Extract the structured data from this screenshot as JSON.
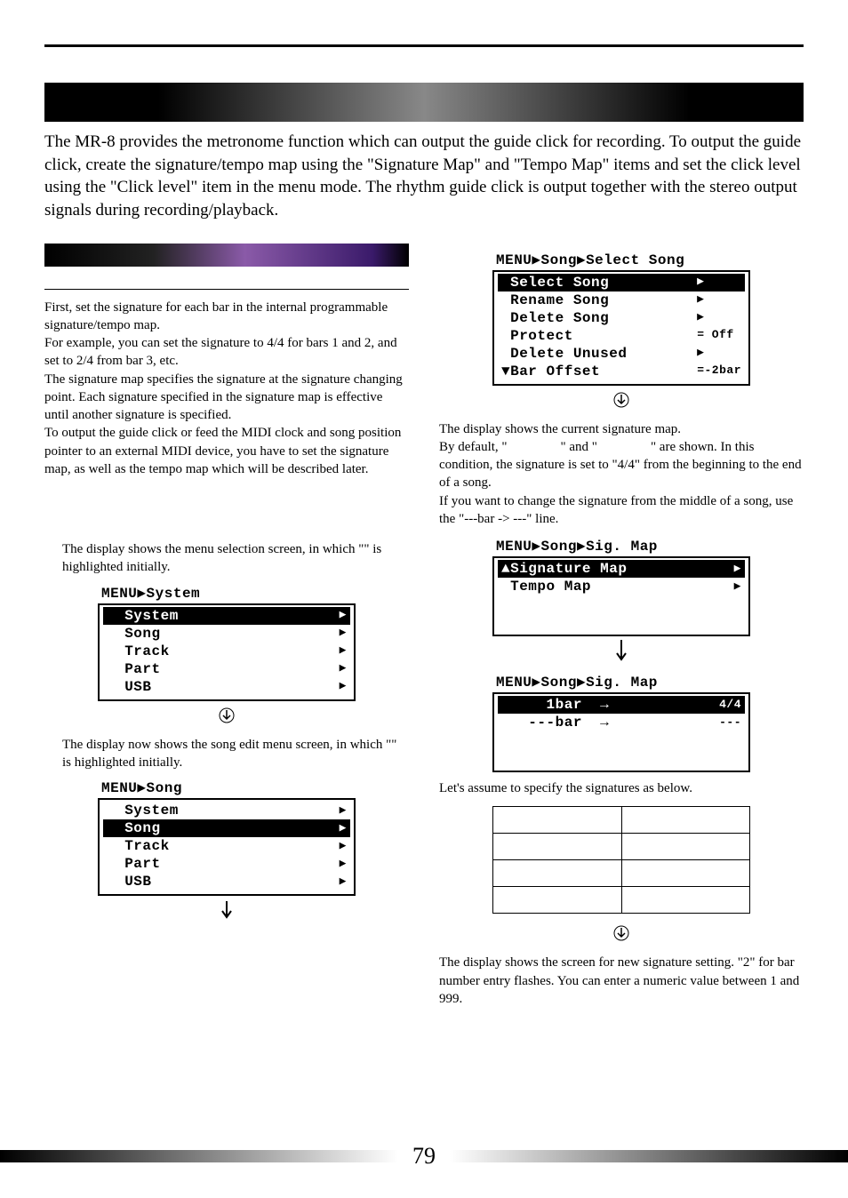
{
  "intro": "The MR-8 provides the metronome function which can output the guide click for recording. To output the guide click, create the signature/tempo map using the \"Signature Map\" and \"Tempo Map\" items and set the click level using the \"Click level\" item in the menu mode. The rhythm guide click is output together with the stereo output signals during recording/playback.",
  "left": {
    "p1": "First, set the signature for each bar in the internal programmable signature/tempo map.",
    "p2": "For example, you can set the signature to 4/4 for bars 1 and 2, and set to 2/4 from bar 3, etc.",
    "p3": "The signature map specifies the signature at the signature changing point. Each signature specified in the signature map is effective until another signature is specified.",
    "p4": "To output the guide click or feed the MIDI clock and song position pointer to an external MIDI device, you have to set the signature map, as well as the tempo map which will be described later.",
    "step1a": "The display shows the menu selection screen, in which \"",
    "step1b": "\" is highlighted initially.",
    "step2a": "The display now shows the song edit menu screen, in which \"",
    "step2b": "\" is highlighted initially."
  },
  "right": {
    "p1a": "The display shows the current signature map.",
    "p1b": "By default, \"",
    "p1c": "\" and \"",
    "p1d": "\" are shown. In this condition, the signature is set to \"4/4\" from the beginning to the end of a song.",
    "p2": "If you want to change the signature from the middle of a song, use the \"---bar -> ---\" line.",
    "p3": "Let's assume to specify the signatures as below.",
    "p4": "The display shows the screen for new signature setting. \"2\" for bar number entry flashes. You can enter a numeric value between 1 and 999."
  },
  "lcd1": {
    "title": "MENU▶System",
    "rows": [
      {
        "label": "  System",
        "arrow": "▶",
        "inv": true
      },
      {
        "label": "  Song",
        "arrow": "▶",
        "inv": false
      },
      {
        "label": "  Track",
        "arrow": "▶",
        "inv": false
      },
      {
        "label": "  Part",
        "arrow": "▶",
        "inv": false
      },
      {
        "label": "  USB",
        "arrow": "▶",
        "inv": false
      }
    ]
  },
  "lcd2": {
    "title": "MENU▶Song",
    "rows": [
      {
        "label": "  System",
        "arrow": "▶",
        "inv": false
      },
      {
        "label": "  Song",
        "arrow": "▶",
        "inv": true
      },
      {
        "label": "  Track",
        "arrow": "▶",
        "inv": false
      },
      {
        "label": "  Part",
        "arrow": "▶",
        "inv": false
      },
      {
        "label": "  USB",
        "arrow": "▶",
        "inv": false
      }
    ]
  },
  "lcd3": {
    "title": "MENU▶Song▶Select Song",
    "rows": [
      {
        "label": " Select Song",
        "arrow": "▶     ",
        "inv": true
      },
      {
        "label": " Rename Song",
        "arrow": "▶     ",
        "inv": false
      },
      {
        "label": " Delete Song",
        "arrow": "▶     ",
        "inv": false
      },
      {
        "label": " Protect",
        "arrow": "= Off ",
        "inv": false
      },
      {
        "label": " Delete Unused",
        "arrow": "▶     ",
        "inv": false
      },
      {
        "label": "▼Bar Offset",
        "arrow": "=-2bar",
        "inv": false
      }
    ]
  },
  "lcd4": {
    "title": "MENU▶Song▶Sig. Map",
    "rows": [
      {
        "label": "▲Signature Map",
        "arrow": "▶",
        "inv": true
      },
      {
        "label": " Tempo Map",
        "arrow": "▶",
        "inv": false
      },
      {
        "label": " ",
        "arrow": " ",
        "inv": false
      },
      {
        "label": " ",
        "arrow": " ",
        "inv": false
      }
    ]
  },
  "lcd5": {
    "title": "MENU▶Song▶Sig. Map",
    "rows": [
      {
        "label": "     1bar  →",
        "arrow": "4/4",
        "inv": true
      },
      {
        "label": "   ---bar  →",
        "arrow": "---",
        "inv": false
      },
      {
        "label": " ",
        "arrow": " ",
        "inv": false
      },
      {
        "label": " ",
        "arrow": " ",
        "inv": false
      }
    ]
  },
  "sig_table": {
    "headers": [
      "",
      ""
    ],
    "rows": [
      [
        "",
        ""
      ],
      [
        "",
        ""
      ],
      [
        "",
        ""
      ]
    ]
  },
  "page_number": "79"
}
